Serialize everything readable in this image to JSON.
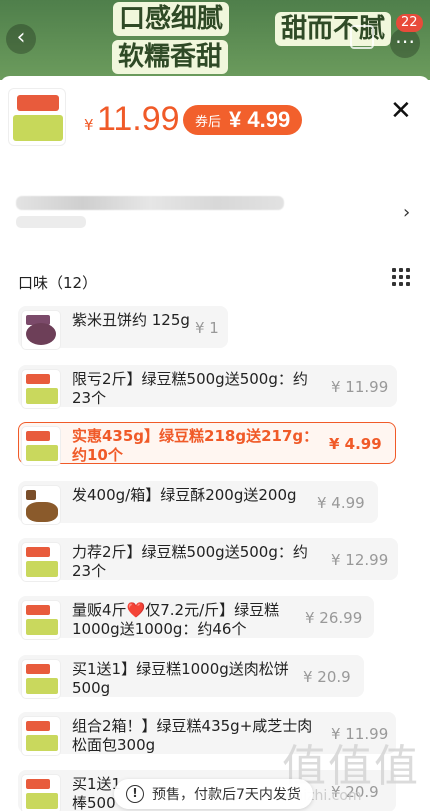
{
  "banner": {
    "line1": "口感细腻",
    "line2": "甜而不腻",
    "line3": "软糯香甜",
    "cart_count": "22",
    "back_icon": "chevron-left-icon",
    "more_icon": "ellipsis-icon"
  },
  "header": {
    "currency": "¥",
    "price": "11.99",
    "coupon_prefix": "券后",
    "coupon_price": "¥ 4.99",
    "close_label": "✕"
  },
  "section": {
    "title": "口味（12）"
  },
  "options": [
    {
      "name": "紫米丑饼约 125g",
      "price": "¥ 1",
      "img": "purple"
    },
    {
      "name": "限亏2斤】绿豆糕500g送500g：约\n23个",
      "price": "¥ 11.99",
      "img": "green"
    },
    {
      "name": "实惠435g】绿豆糕218g送217g：\n约10个",
      "price": "¥ 4.99",
      "img": "green",
      "selected": true
    },
    {
      "name": "发400g/箱】绿豆酥200g送200g",
      "price": "¥ 4.99",
      "img": "brown"
    },
    {
      "name": "力荐2斤】绿豆糕500g送500g：约\n23个",
      "price": "¥ 12.99",
      "img": "green"
    },
    {
      "name": "量贩4斤❤️仅7.2元/斤】绿豆糕\n1000g送1000g：约46个",
      "price": "¥ 26.99",
      "img": "green"
    },
    {
      "name": "买1送1】绿豆糕1000g送肉松饼\n500g",
      "price": "¥ 20.9",
      "img": "green"
    },
    {
      "name": "组合2箱！】绿豆糕435g+咸芝士肉\n松面包300g",
      "price": "¥ 11.99",
      "img": "green"
    },
    {
      "name": "买1送1\n棒500",
      "price": "¥ 20.9",
      "img": "green"
    }
  ],
  "toast": {
    "text": "预售，付款后7天内发货"
  },
  "watermark": {
    "text": "值值值",
    "url": "zhizhi.com"
  }
}
